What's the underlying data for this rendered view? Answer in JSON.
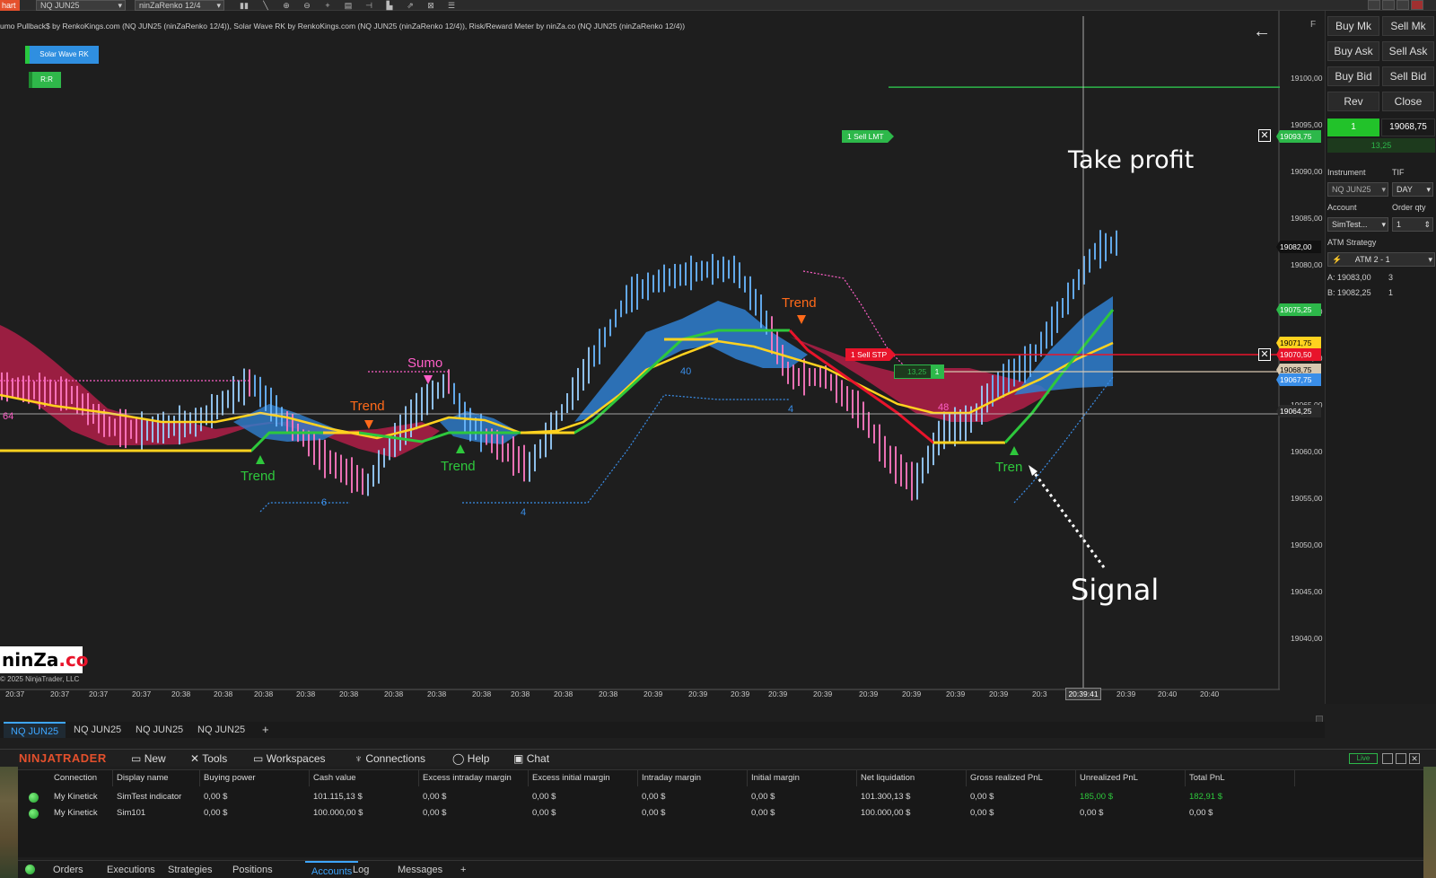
{
  "toolbar": {
    "chart_tab": "hart",
    "instrument_select": "NQ JUN25",
    "bartype_select": "ninZaRenko 12/4"
  },
  "chart": {
    "description": "umo Pullback$ by RenkoKings.com (NQ JUN25 (ninZaRenko 12/4)), Solar Wave RK by RenkoKings.com (NQ JUN25 (ninZaRenko 12/4)), Risk/Reward Meter by ninZa.co (NQ JUN25 (ninZaRenko 12/4))",
    "indicator_buttons": [
      "Solar Wave RK",
      "R:R"
    ],
    "f_label": "F",
    "price_ticks": [
      "19100,00",
      "19095,00",
      "19090,00",
      "19085,00",
      "19080,00",
      "19075,00",
      "19070,00",
      "19065,00",
      "19060,00",
      "19055,00",
      "19050,00",
      "19045,00",
      "19040,00"
    ],
    "price_markers": [
      {
        "value": "19093,75",
        "bg": "#2db84a",
        "fg": "#ffffff"
      },
      {
        "value": "19082,00",
        "bg": "#111111",
        "fg": "#ffffff"
      },
      {
        "value": "19075,25",
        "bg": "#2db84a",
        "fg": "#ffffff"
      },
      {
        "value": "19071,75",
        "bg": "#ffd21f",
        "fg": "#000000"
      },
      {
        "value": "19070,50",
        "bg": "#e8142b",
        "fg": "#ffffff"
      },
      {
        "value": "19068,75",
        "bg": "#d8c8b0",
        "fg": "#000000"
      },
      {
        "value": "19067,75",
        "bg": "#3a8ee8",
        "fg": "#ffffff"
      },
      {
        "value": "19064,25",
        "bg": "#2a2a2a",
        "fg": "#ffffff"
      }
    ],
    "time_ticks": [
      "20:37",
      "20:37",
      "20:37",
      "20:37",
      "20:38",
      "20:38",
      "20:38",
      "20:38",
      "20:38",
      "20:38",
      "20:38",
      "20:38",
      "20:38",
      "20:38",
      "20:38",
      "20:39",
      "20:39",
      "20:39",
      "20:39",
      "20:39",
      "20:39",
      "20:39",
      "20:39",
      "20:39",
      "20:3",
      "20:39",
      "20:39",
      "20:40",
      "20:40"
    ],
    "crosshair_time": "20:39:41",
    "signal_labels": [
      {
        "text": "Trend",
        "color": "#2ec83c"
      },
      {
        "text": "Trend",
        "color": "#ff6a1a"
      },
      {
        "text": "Trend",
        "color": "#2ec83c"
      },
      {
        "text": "Sumo",
        "color": "#ff5fc8"
      },
      {
        "text": "Trend",
        "color": "#ff6a1a"
      },
      {
        "text": "Tren",
        "color": "#2ec83c"
      }
    ],
    "wave_numbers": [
      "64",
      "6",
      "4",
      "40",
      "4",
      "48"
    ],
    "orders": {
      "sell_limit": "1  Sell LMT",
      "sell_stop": "1  Sell STP",
      "position_pnl": "13,25",
      "position_qty": "1"
    },
    "annotations": {
      "take_profit": "Take profit",
      "signal": "Signal"
    },
    "logo": {
      "text_a": "ninZa",
      "text_b": ".co"
    },
    "copyright": "© 2025 NinjaTrader, LLC"
  },
  "trade_panel": {
    "buttons": [
      "Buy Mk",
      "Sell Mk",
      "Buy Ask",
      "Sell Ask",
      "Buy Bid",
      "Sell Bid",
      "Rev",
      "Close"
    ],
    "position_qty": "1",
    "avg_price": "19068,75",
    "unrealized": "13,25",
    "instrument_label": "Instrument",
    "tif_label": "TIF",
    "instrument_value": "NQ JUN25",
    "tif_value": "DAY",
    "account_label": "Account",
    "order_qty_label": "Order qty",
    "account_value": "SimTest...",
    "order_qty_value": "1",
    "atm_label": "ATM Strategy",
    "atm_value": "ATM 2 - 1",
    "ask_label": "A:",
    "ask_price": "19083,00",
    "ask_size": "3",
    "bid_label": "B:",
    "bid_price": "19082,25",
    "bid_size": "1"
  },
  "chart_tabs": [
    "NQ JUN25",
    "NQ JUN25",
    "NQ JUN25",
    "NQ JUN25"
  ],
  "add_tab": "+",
  "control_center": {
    "brand": "NINJATRADER",
    "menu": [
      "New",
      "Tools",
      "Workspaces",
      "Connections",
      "Help",
      "Chat"
    ],
    "live_badge": "Live",
    "columns": [
      "Connection",
      "Display name",
      "Buying power",
      "Cash value",
      "Excess intraday margin",
      "Excess initial margin",
      "Intraday margin",
      "Initial margin",
      "Net liquidation",
      "Gross realized PnL",
      "Unrealized PnL",
      "Total PnL"
    ],
    "rows": [
      [
        "My Kinetick",
        "SimTest indicator",
        "0,00 $",
        "101.115,13 $",
        "0,00 $",
        "0,00 $",
        "0,00 $",
        "0,00 $",
        "101.300,13 $",
        "0,00 $",
        "185,00 $",
        "182,91 $"
      ],
      [
        "My Kinetick",
        "Sim101",
        "0,00 $",
        "100.000,00 $",
        "0,00 $",
        "0,00 $",
        "0,00 $",
        "0,00 $",
        "100.000,00 $",
        "0,00 $",
        "0,00 $",
        "0,00 $"
      ]
    ],
    "bottom_tabs": [
      "Orders",
      "Executions",
      "Strategies",
      "Positions",
      "Accounts",
      "Log",
      "Messages",
      "+"
    ],
    "active_bottom_tab": "Accounts"
  }
}
